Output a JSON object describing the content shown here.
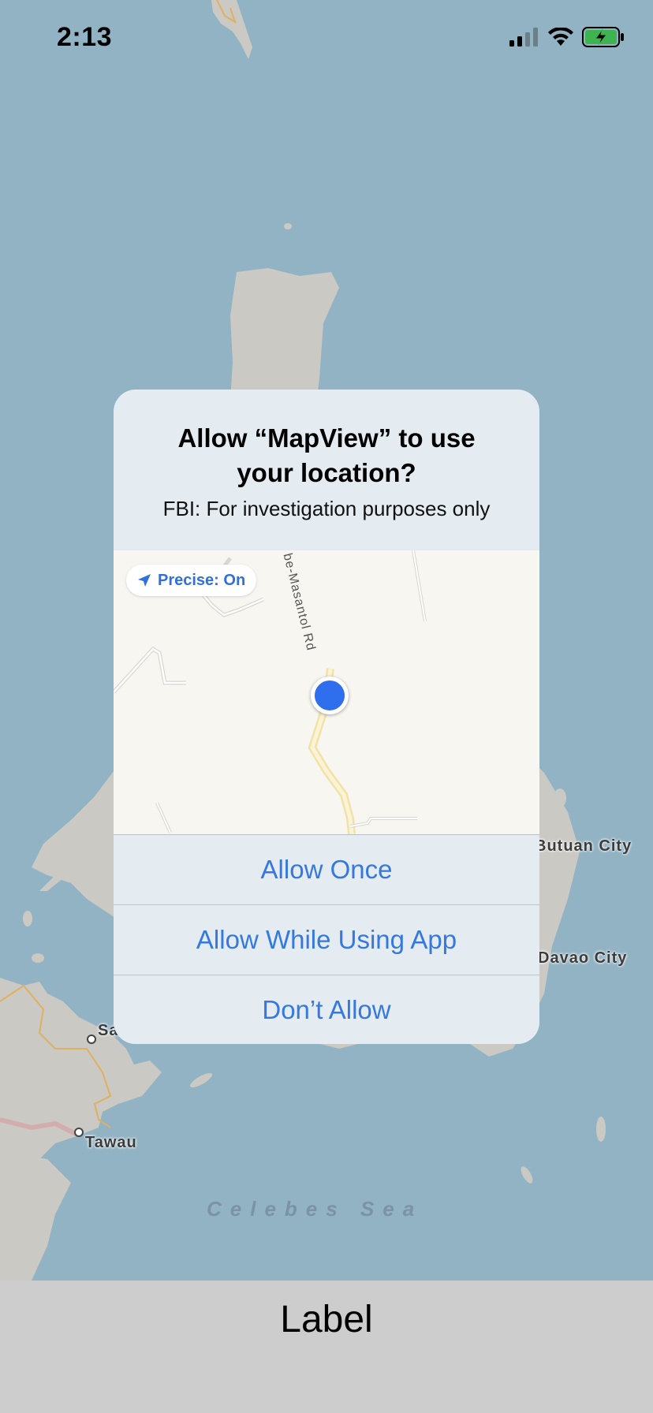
{
  "status_bar": {
    "time": "2:13",
    "icons": [
      "cellular-signal-icon",
      "wifi-icon",
      "battery-charging-icon"
    ]
  },
  "map": {
    "labels": {
      "butuan": "Butuan City",
      "davao": "Davao City",
      "sa": "Sa",
      "tawau": "Tawau"
    },
    "sea_label": "Celebes Sea"
  },
  "dialog": {
    "title": "Allow “MapView” to use your location?",
    "message": "FBI: For investigation purposes only",
    "precise_label": "Precise: On",
    "road_label": "be-Masantol Rd",
    "buttons": {
      "allow_once": "Allow Once",
      "allow_while_using": "Allow While Using App",
      "dont_allow": "Don’t Allow"
    }
  },
  "bottom": {
    "label": "Label"
  },
  "colors": {
    "accent": "#3478e0",
    "water": "#92b3c4",
    "land": "#cbc9c4"
  }
}
